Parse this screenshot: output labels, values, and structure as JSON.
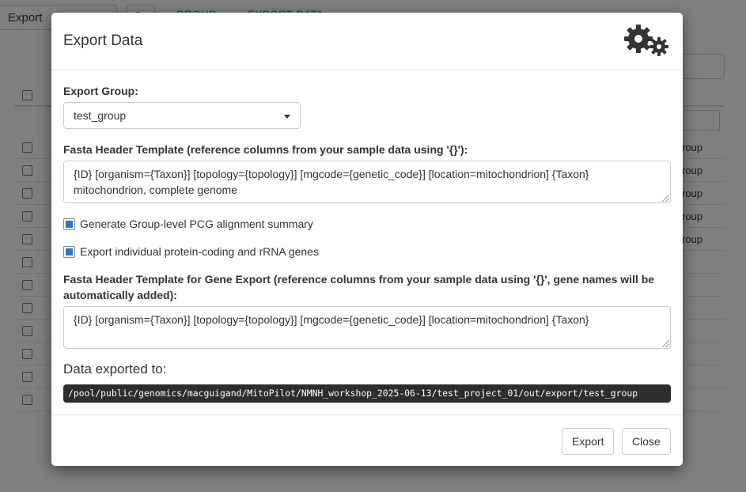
{
  "background": {
    "toolbar_label": "Export",
    "refresh_icon": "refresh-icon",
    "tabs": [
      "GROUP",
      "EXPORT DATA"
    ],
    "row_texts": [
      "roup",
      "roup",
      "roup",
      "roup",
      "roup"
    ]
  },
  "modal": {
    "title": "Export Data",
    "header_icon": "gears-icon",
    "export_group": {
      "label": "Export Group:",
      "selected": "test_group"
    },
    "fasta_template": {
      "label": "Fasta Header Template (reference columns from your sample data using '{}'):",
      "value": "{ID} [organism={Taxon}] [topology={topology}] [mgcode={genetic_code}] [location=mitochondrion] {Taxon} mitochondrion, complete genome"
    },
    "options": [
      {
        "label": "Generate Group-level PCG alignment summary",
        "checked": true
      },
      {
        "label": "Export individual protein-coding and rRNA genes",
        "checked": true
      }
    ],
    "gene_template": {
      "label": "Fasta Header Template for Gene Export (reference columns from your sample data using '{}', gene names will be automatically added):",
      "value": "{ID} [organism={Taxon}] [topology={topology}] [mgcode={genetic_code}] [location=mitochondrion] {Taxon}"
    },
    "export_path": {
      "title": "Data exported to:",
      "path": "/pool/public/genomics/macguigand/MitoPilot/NMNH_workshop_2025-06-13/test_project_01/out/export/test_group"
    },
    "footer": {
      "export_label": "Export",
      "close_label": "Close"
    }
  },
  "colors": {
    "accent": "#337ab7",
    "checkbox_fill": "#2f75c1",
    "code_bg": "#2d2d2d"
  }
}
